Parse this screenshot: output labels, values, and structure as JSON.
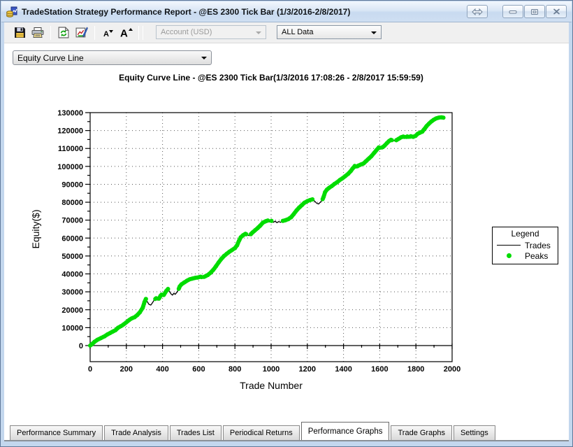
{
  "window": {
    "title": "TradeStation Strategy Performance Report - @ES 2300 Tick Bar (1/3/2016-2/8/2017)",
    "icon": "tradestation-report-icon",
    "controls": [
      {
        "name": "restore-toggle",
        "icon": "double-arrow-icon"
      },
      {
        "name": "minimize",
        "icon": "minimize-icon"
      },
      {
        "name": "maximize",
        "icon": "restore-icon"
      },
      {
        "name": "close",
        "icon": "close-icon"
      }
    ]
  },
  "toolbar": {
    "buttons": [
      {
        "name": "save",
        "icon": "floppy-disk-icon"
      },
      {
        "name": "print",
        "icon": "printer-icon"
      },
      {
        "name": "refresh",
        "icon": "refresh-page-icon"
      },
      {
        "name": "export-report",
        "icon": "report-edit-icon"
      },
      {
        "name": "decrease-font",
        "icon": "font-smaller-icon"
      },
      {
        "name": "increase-font",
        "icon": "font-larger-icon"
      }
    ],
    "account_dropdown": {
      "value": "Account (USD)",
      "disabled": true
    },
    "data_dropdown": {
      "value": "ALL Data",
      "disabled": false
    }
  },
  "graph_selector": {
    "value": "Equity Curve Line"
  },
  "legend": {
    "title": "Legend",
    "items": [
      {
        "label": "Trades",
        "type": "line",
        "color": "#000000"
      },
      {
        "label": "Peaks",
        "type": "dot",
        "color": "#00dc00"
      }
    ]
  },
  "tabs": [
    {
      "label": "Performance Summary",
      "active": false
    },
    {
      "label": "Trade Analysis",
      "active": false
    },
    {
      "label": "Trades List",
      "active": false
    },
    {
      "label": "Periodical Returns",
      "active": false
    },
    {
      "label": "Performance Graphs",
      "active": true
    },
    {
      "label": "Trade Graphs",
      "active": false
    },
    {
      "label": "Settings",
      "active": false
    }
  ],
  "colors": {
    "peaks_green": "#00dc00",
    "trades_black": "#000000",
    "titlebar_blue": "#cfe0f2",
    "toolbar_gray": "#f0f0f0"
  },
  "chart_data": {
    "type": "line",
    "title": "Equity Curve Line - @ES 2300 Tick Bar(1/3/2016 17:08:26 - 2/8/2017 15:59:59)",
    "xlabel": "Trade Number",
    "ylabel": "Equity($)",
    "xlim": [
      0,
      2000
    ],
    "ylim": [
      -9000,
      130000
    ],
    "x_tick_step": 200,
    "x_minor_tick_step": 100,
    "y_tick_step": 10000,
    "y_minor_tick_step": 5000,
    "grid": "dotted-at-major-ticks",
    "legend_position": "right",
    "series": [
      {
        "name": "Trades",
        "type": "line",
        "color": "#000000",
        "points": [
          [
            0,
            0
          ],
          [
            10,
            800
          ],
          [
            25,
            2200
          ],
          [
            40,
            3200
          ],
          [
            60,
            4200
          ],
          [
            80,
            5200
          ],
          [
            95,
            6200
          ],
          [
            110,
            7000
          ],
          [
            125,
            7800
          ],
          [
            140,
            8600
          ],
          [
            155,
            10000
          ],
          [
            170,
            10800
          ],
          [
            185,
            11800
          ],
          [
            200,
            13000
          ],
          [
            215,
            14200
          ],
          [
            230,
            15200
          ],
          [
            245,
            15800
          ],
          [
            260,
            17000
          ],
          [
            275,
            18600
          ],
          [
            290,
            21000
          ],
          [
            300,
            24200
          ],
          [
            308,
            26000
          ],
          [
            315,
            24600
          ],
          [
            325,
            23000
          ],
          [
            335,
            22600
          ],
          [
            345,
            24000
          ],
          [
            355,
            25600
          ],
          [
            365,
            26400
          ],
          [
            372,
            25400
          ],
          [
            380,
            26200
          ],
          [
            388,
            27600
          ],
          [
            395,
            28400
          ],
          [
            403,
            27600
          ],
          [
            410,
            28800
          ],
          [
            420,
            30400
          ],
          [
            430,
            31600
          ],
          [
            438,
            30200
          ],
          [
            447,
            28800
          ],
          [
            455,
            28200
          ],
          [
            463,
            29200
          ],
          [
            470,
            28600
          ],
          [
            478,
            29600
          ],
          [
            487,
            31000
          ],
          [
            495,
            33000
          ],
          [
            505,
            34200
          ],
          [
            520,
            35200
          ],
          [
            535,
            36200
          ],
          [
            550,
            37000
          ],
          [
            565,
            37400
          ],
          [
            580,
            37800
          ],
          [
            595,
            38000
          ],
          [
            610,
            38400
          ],
          [
            622,
            38000
          ],
          [
            635,
            38600
          ],
          [
            650,
            39400
          ],
          [
            665,
            40600
          ],
          [
            680,
            42200
          ],
          [
            695,
            44200
          ],
          [
            710,
            46400
          ],
          [
            725,
            48400
          ],
          [
            740,
            50000
          ],
          [
            755,
            51200
          ],
          [
            770,
            52400
          ],
          [
            785,
            53400
          ],
          [
            800,
            54400
          ],
          [
            812,
            56000
          ],
          [
            822,
            58400
          ],
          [
            832,
            60400
          ],
          [
            845,
            61600
          ],
          [
            858,
            62400
          ],
          [
            868,
            61800
          ],
          [
            878,
            61400
          ],
          [
            888,
            62200
          ],
          [
            898,
            63200
          ],
          [
            912,
            64400
          ],
          [
            926,
            65600
          ],
          [
            940,
            67000
          ],
          [
            955,
            68600
          ],
          [
            970,
            69400
          ],
          [
            982,
            69800
          ],
          [
            992,
            69000
          ],
          [
            1002,
            69600
          ],
          [
            1012,
            68800
          ],
          [
            1022,
            69400
          ],
          [
            1032,
            68600
          ],
          [
            1042,
            69200
          ],
          [
            1052,
            68800
          ],
          [
            1065,
            69600
          ],
          [
            1080,
            70000
          ],
          [
            1095,
            70600
          ],
          [
            1110,
            71600
          ],
          [
            1125,
            73400
          ],
          [
            1140,
            75400
          ],
          [
            1155,
            77000
          ],
          [
            1170,
            78400
          ],
          [
            1185,
            79800
          ],
          [
            1200,
            80600
          ],
          [
            1215,
            81200
          ],
          [
            1228,
            81600
          ],
          [
            1240,
            80600
          ],
          [
            1252,
            79400
          ],
          [
            1262,
            79000
          ],
          [
            1272,
            80000
          ],
          [
            1282,
            81000
          ],
          [
            1290,
            83000
          ],
          [
            1298,
            85600
          ],
          [
            1308,
            87000
          ],
          [
            1320,
            88000
          ],
          [
            1335,
            89000
          ],
          [
            1350,
            90200
          ],
          [
            1365,
            91200
          ],
          [
            1380,
            92400
          ],
          [
            1395,
            93400
          ],
          [
            1410,
            94600
          ],
          [
            1425,
            95800
          ],
          [
            1440,
            97400
          ],
          [
            1452,
            99000
          ],
          [
            1462,
            100200
          ],
          [
            1472,
            99600
          ],
          [
            1482,
            100400
          ],
          [
            1495,
            101000
          ],
          [
            1510,
            101600
          ],
          [
            1525,
            103000
          ],
          [
            1540,
            104400
          ],
          [
            1555,
            105800
          ],
          [
            1570,
            107600
          ],
          [
            1583,
            109200
          ],
          [
            1595,
            110600
          ],
          [
            1607,
            110200
          ],
          [
            1617,
            110800
          ],
          [
            1627,
            111600
          ],
          [
            1640,
            113000
          ],
          [
            1652,
            114200
          ],
          [
            1662,
            114800
          ],
          [
            1672,
            114400
          ],
          [
            1682,
            114200
          ],
          [
            1692,
            114600
          ],
          [
            1705,
            115400
          ],
          [
            1718,
            116200
          ],
          [
            1730,
            116600
          ],
          [
            1742,
            116200
          ],
          [
            1752,
            116700
          ],
          [
            1762,
            116300
          ],
          [
            1772,
            116800
          ],
          [
            1785,
            116500
          ],
          [
            1798,
            117000
          ],
          [
            1810,
            118200
          ],
          [
            1822,
            118800
          ],
          [
            1835,
            119400
          ],
          [
            1848,
            121000
          ],
          [
            1860,
            122600
          ],
          [
            1872,
            123800
          ],
          [
            1885,
            125000
          ],
          [
            1898,
            126000
          ],
          [
            1912,
            126800
          ],
          [
            1925,
            127200
          ],
          [
            1940,
            127400
          ],
          [
            1952,
            127200
          ]
        ]
      },
      {
        "name": "Peaks",
        "type": "scatter",
        "color": "#00dc00",
        "rule": "dot at every new equity high of the Trades series",
        "derived_from": "Trades"
      }
    ]
  }
}
